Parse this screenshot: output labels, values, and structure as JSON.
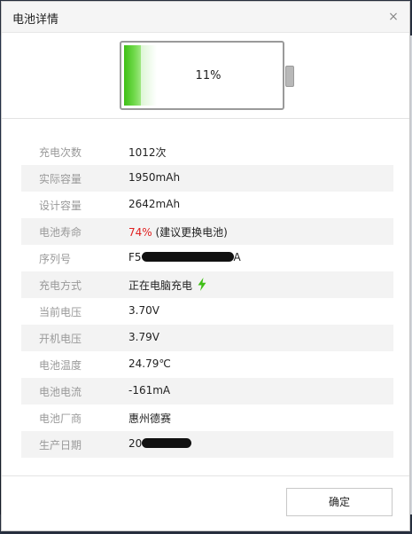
{
  "dialog": {
    "title": "电池详情",
    "close_label": "×",
    "ok_label": "确定"
  },
  "battery": {
    "percent_text": "11%",
    "level": 0.11,
    "fill_color": "#4cc21f"
  },
  "rows": [
    {
      "label": "充电次数",
      "value": "1012次"
    },
    {
      "label": "实际容量",
      "value": "1950mAh"
    },
    {
      "label": "设计容量",
      "value": "2642mAh"
    },
    {
      "label": "电池寿命",
      "value_highlight": "74%",
      "value_note": "(建议更换电池)"
    },
    {
      "label": "序列号",
      "value_prefix": "F5",
      "value_suffix": "A"
    },
    {
      "label": "充电方式",
      "value": "正在电脑充电"
    },
    {
      "label": "当前电压",
      "value": "3.70V"
    },
    {
      "label": "开机电压",
      "value": "3.79V"
    },
    {
      "label": "电池温度",
      "value": "24.79℃"
    },
    {
      "label": "电池电流",
      "value": "-161mA"
    },
    {
      "label": "电池厂商",
      "value": "惠州德赛"
    },
    {
      "label": "生产日期",
      "value_prefix": "20"
    }
  ],
  "colors": {
    "health_warning": "#e02020",
    "charging_icon": "#3fbf16"
  }
}
